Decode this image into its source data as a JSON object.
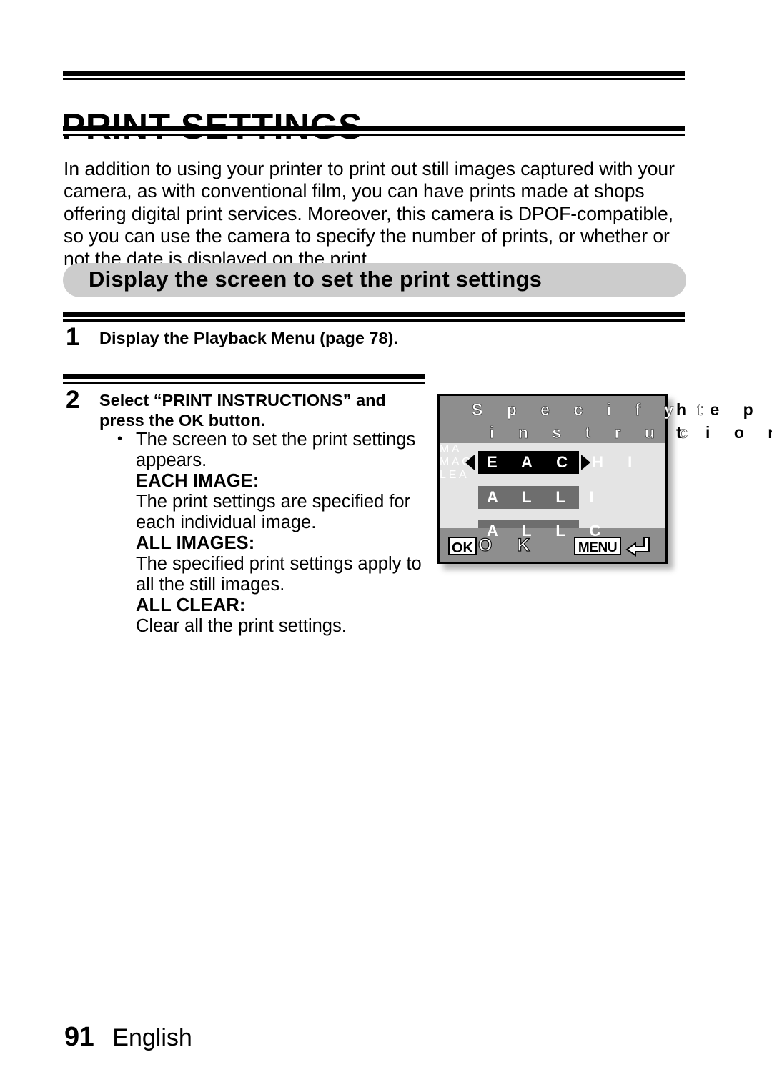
{
  "document": {
    "title": "PRINT SETTINGS",
    "intro": "In addition to using your printer to print out still images captured with your camera, as with conventional film, you can have prints made at shops offering digital print services. Moreover, this camera is DPOF-compatible, so you can use the camera to specify the number of prints, or whether or not the date is displayed on the print.",
    "section_heading": "Display the screen to set the print settings"
  },
  "steps": [
    {
      "number": "1",
      "text": "Display the Playback Menu (page 78)."
    },
    {
      "number": "2",
      "text": "Select “PRINT INSTRUCTIONS” and press the OK button.",
      "bullet": "The screen to set the print settings appears.",
      "options": [
        {
          "name": "EACH IMAGE:",
          "description": "The print settings are specified for each individual image."
        },
        {
          "name": "ALL IMAGES:",
          "description": "The specified print settings apply to all the still images."
        },
        {
          "name": "ALL CLEAR:",
          "description": "Clear all the print settings."
        }
      ]
    }
  ],
  "lcd_screen": {
    "heading_line1": "S p e c i f y t h e p r",
    "heading_line1_inside": "S p e c i f y t",
    "heading_line1_outside": "h e p r",
    "heading_line2": "i n s t r u c t i o n",
    "heading_line2_inside": "i n s t r u c",
    "heading_line2_outside": "t i o n",
    "rows": [
      {
        "label": "E A C H I",
        "full_label": "EACH IMAGE",
        "state": "selected"
      },
      {
        "label": "A L L I",
        "full_label": "ALL IMAGES",
        "state": "normal"
      },
      {
        "label": "A L L C",
        "full_label": "ALL CLEAR",
        "state": "normal"
      }
    ],
    "clipped_text": {
      "row1": "M A",
      "row2": "M A G",
      "row3": "L E A"
    },
    "bottom_bar": {
      "ok_badge": "OK",
      "ok_letters": "O K",
      "menu_badge": "MENU"
    },
    "colors": {
      "band": "#8e8e8e",
      "body": "#e4e4e4",
      "selected_bar": "#000000",
      "normal_bar": "#6e6e6e"
    }
  },
  "footer": {
    "page_number": "91",
    "language": "English"
  },
  "theme": {
    "banner_gray": "#cccccc",
    "rule_black": "#000000"
  }
}
